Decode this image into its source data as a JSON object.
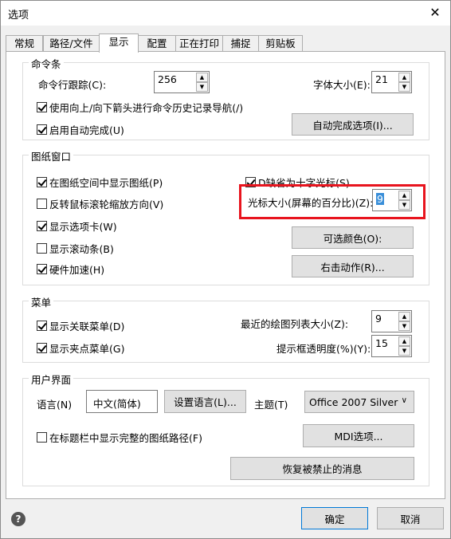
{
  "window": {
    "title": "选项",
    "close_glyph": "✕"
  },
  "tabs": [
    "常规",
    "路径/文件",
    "显示",
    "配置",
    "正在打印",
    "捕捉",
    "剪贴板"
  ],
  "command_bar": {
    "label": "命令条",
    "track_label": "命令行跟踪(C):",
    "track_value": "256",
    "font_size_label": "字体大小(E):",
    "font_size_value": "21",
    "use_arrows_label": "使用向上/向下箭头进行命令历史记录导航(/)",
    "autocomplete_label": "启用自动完成(U)",
    "autocomplete_options_btn": "自动完成选项(I)..."
  },
  "drawing_window": {
    "label": "图纸窗口",
    "show_drawing_label": "在图纸空间中显示图纸(P)",
    "crosshair_label": "D缺省为十字光标(S)",
    "reverse_wheel_label": "反转鼠标滚轮缩放方向(V)",
    "cursor_size_label": "光标大小(屏幕的百分比)(Z):",
    "cursor_size_value": "9",
    "show_tabs_label": "显示选项卡(W)",
    "colors_btn": "可选颜色(O):",
    "show_scrollbars_label": "显示滚动条(B)",
    "hw_accel_label": "硬件加速(H)",
    "right_click_btn": "右击动作(R)..."
  },
  "menu": {
    "label": "菜单",
    "context_menu_label": "显示关联菜单(D)",
    "recent_list_label": "最近的绘图列表大小(Z):",
    "recent_list_value": "9",
    "grip_menu_label": "显示夹点菜单(G)",
    "tooltip_opacity_label": "提示框透明度(%)(Y):",
    "tooltip_opacity_value": "15"
  },
  "ui": {
    "label": "用户界面",
    "language_label": "语言(N)",
    "language_value": "中文(简体)",
    "set_language_btn": "设置语言(L)...",
    "theme_label": "主题(T)",
    "theme_value": "Office 2007 Silver",
    "full_path_label": "在标题栏中显示完整的图纸路径(F)",
    "mdi_btn": "MDI选项...",
    "restore_btn": "恢复被禁止的消息"
  },
  "footer": {
    "help_glyph": "?",
    "ok": "确定",
    "cancel": "取消"
  },
  "accent": "#e8141e"
}
